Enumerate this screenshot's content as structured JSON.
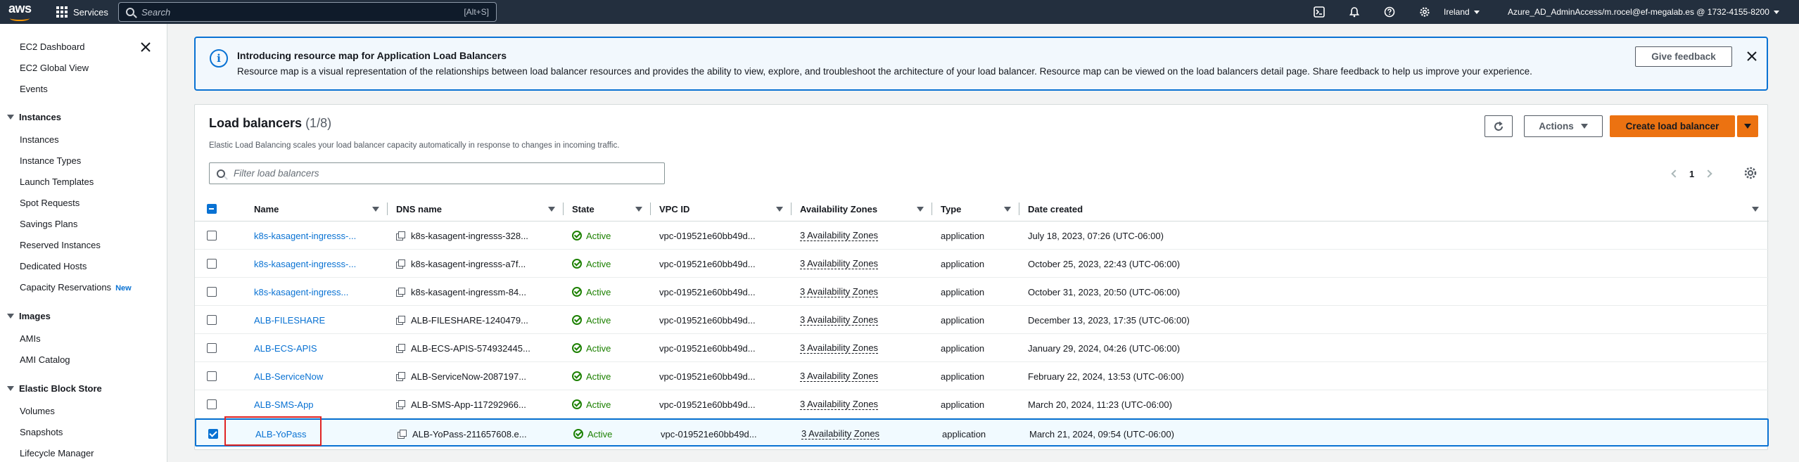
{
  "topnav": {
    "logo_text": "aws",
    "services_label": "Services",
    "search_placeholder": "Search",
    "search_shortcut": "[Alt+S]",
    "icons": [
      "cloudshell-icon",
      "bell-icon",
      "help-icon",
      "gear-icon"
    ],
    "region": "Ireland",
    "account": "Azure_AD_AdminAccess/m.rocel@ef-megalab.es @ 1732-4155-8200"
  },
  "sidebar": {
    "top_links": [
      "EC2 Dashboard",
      "EC2 Global View",
      "Events"
    ],
    "sections": [
      {
        "title": "Instances",
        "items": [
          "Instances",
          "Instance Types",
          "Launch Templates",
          "Spot Requests",
          "Savings Plans",
          "Reserved Instances",
          "Dedicated Hosts",
          "Capacity Reservations"
        ]
      },
      {
        "title": "Images",
        "items": [
          "AMIs",
          "AMI Catalog"
        ]
      },
      {
        "title": "Elastic Block Store",
        "items": [
          "Volumes",
          "Snapshots",
          "Lifecycle Manager"
        ]
      }
    ],
    "new_badge": "New"
  },
  "flash": {
    "title": "Introducing resource map for Application Load Balancers",
    "body": "Resource map is a visual representation of the relationships between load balancer resources and provides the ability to view, explore, and troubleshoot the architecture of your load balancer. Resource map can be viewed on the load balancers detail page. Share feedback to help us improve your experience.",
    "feedback_label": "Give feedback"
  },
  "panel": {
    "title": "Load balancers",
    "count": "(1/8)",
    "description": "Elastic Load Balancing scales your load balancer capacity automatically in response to changes in incoming traffic.",
    "actions_label": "Actions",
    "create_label": "Create load balancer",
    "filter_placeholder": "Filter load balancers",
    "page_number": "1"
  },
  "table": {
    "columns": [
      "Name",
      "DNS name",
      "State",
      "VPC ID",
      "Availability Zones",
      "Type",
      "Date created"
    ],
    "rows": [
      {
        "name": "k8s-kasagent-ingresss-...",
        "dns": "k8s-kasagent-ingresss-328...",
        "state": "Active",
        "vpc": "vpc-019521e60bb49d...",
        "az": "3 Availability Zones",
        "type": "application",
        "date": "July 18, 2023, 07:26 (UTC-06:00)",
        "selected": false
      },
      {
        "name": "k8s-kasagent-ingresss-...",
        "dns": "k8s-kasagent-ingresss-a7f...",
        "state": "Active",
        "vpc": "vpc-019521e60bb49d...",
        "az": "3 Availability Zones",
        "type": "application",
        "date": "October 25, 2023, 22:43 (UTC-06:00)",
        "selected": false
      },
      {
        "name": "k8s-kasagent-ingress...",
        "dns": "k8s-kasagent-ingressm-84...",
        "state": "Active",
        "vpc": "vpc-019521e60bb49d...",
        "az": "3 Availability Zones",
        "type": "application",
        "date": "October 31, 2023, 20:50 (UTC-06:00)",
        "selected": false
      },
      {
        "name": "ALB-FILESHARE",
        "dns": "ALB-FILESHARE-1240479...",
        "state": "Active",
        "vpc": "vpc-019521e60bb49d...",
        "az": "3 Availability Zones",
        "type": "application",
        "date": "December 13, 2023, 17:35 (UTC-06:00)",
        "selected": false
      },
      {
        "name": "ALB-ECS-APIS",
        "dns": "ALB-ECS-APIS-574932445...",
        "state": "Active",
        "vpc": "vpc-019521e60bb49d...",
        "az": "3 Availability Zones",
        "type": "application",
        "date": "January 29, 2024, 04:26 (UTC-06:00)",
        "selected": false
      },
      {
        "name": "ALB-ServiceNow",
        "dns": "ALB-ServiceNow-2087197...",
        "state": "Active",
        "vpc": "vpc-019521e60bb49d...",
        "az": "3 Availability Zones",
        "type": "application",
        "date": "February 22, 2024, 13:53 (UTC-06:00)",
        "selected": false
      },
      {
        "name": "ALB-SMS-App",
        "dns": "ALB-SMS-App-117292966...",
        "state": "Active",
        "vpc": "vpc-019521e60bb49d...",
        "az": "3 Availability Zones",
        "type": "application",
        "date": "March 20, 2024, 11:23 (UTC-06:00)",
        "selected": false
      },
      {
        "name": "ALB-YoPass",
        "dns": "ALB-YoPass-211657608.e...",
        "state": "Active",
        "vpc": "vpc-019521e60bb49d...",
        "az": "3 Availability Zones",
        "type": "application",
        "date": "March 21, 2024, 09:54 (UTC-06:00)",
        "selected": true
      }
    ]
  },
  "colors": {
    "nav_bg": "#232f3e",
    "link": "#0972d3",
    "primary_button": "#ec7211",
    "status_ok": "#1d8102",
    "highlight": "#e02424"
  }
}
